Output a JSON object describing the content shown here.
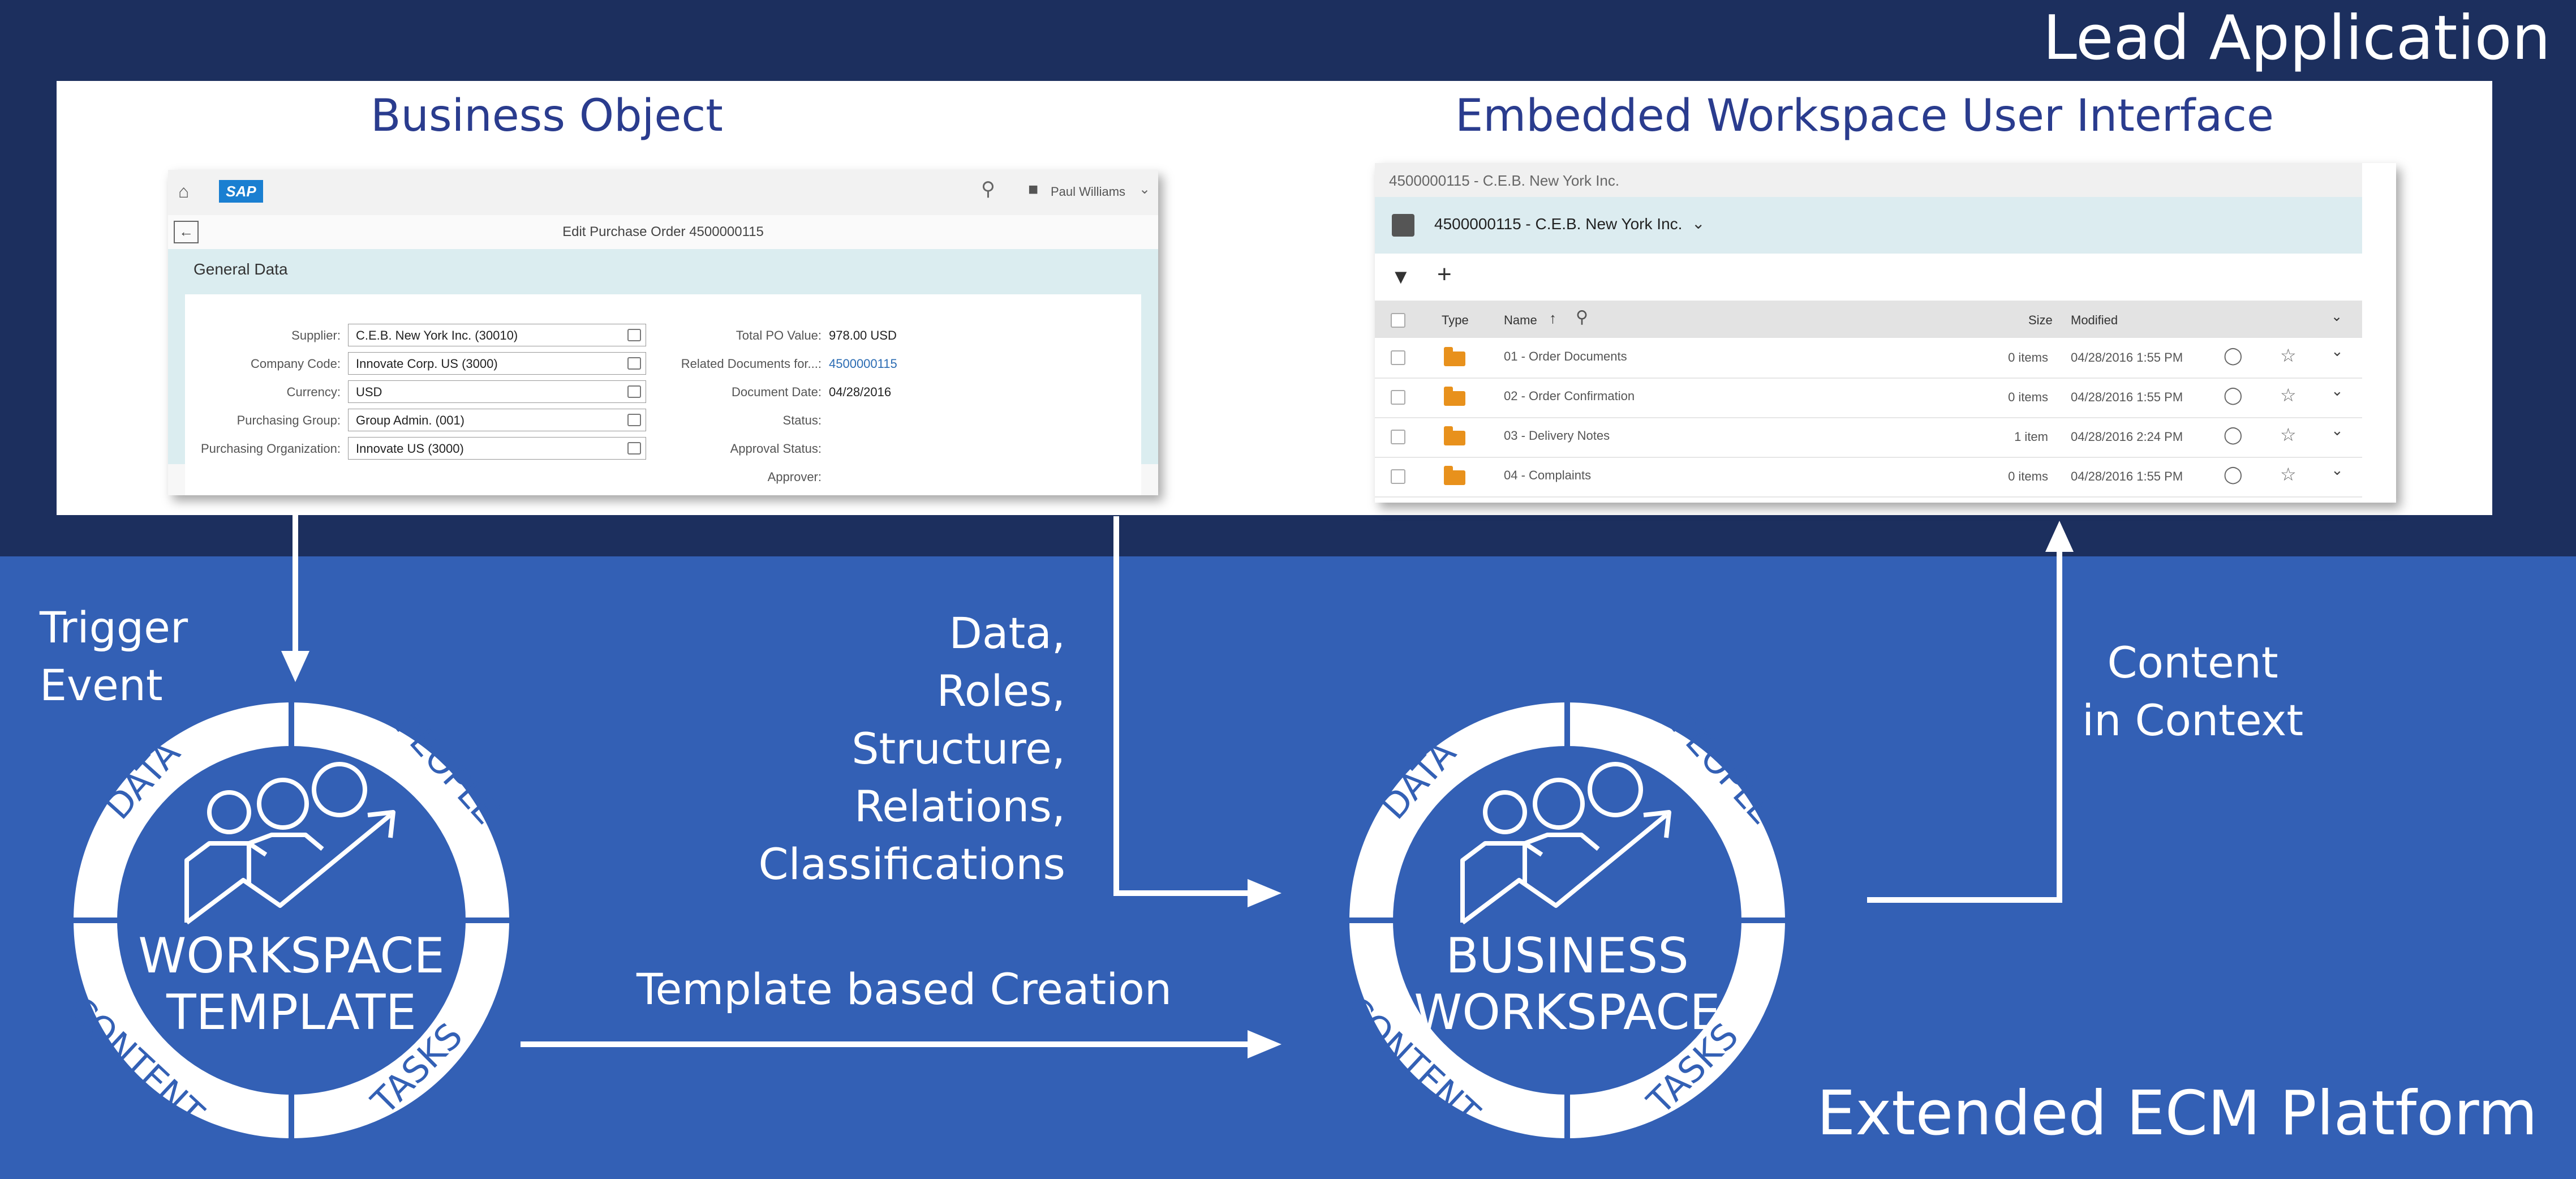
{
  "titles": {
    "lead": "Lead Application",
    "business_object": "Business Object",
    "embedded_ui": "Embedded Workspace User Interface",
    "platform": "Extended ECM Platform"
  },
  "labels": {
    "trigger_line1": "Trigger",
    "trigger_line2": "Event",
    "data_lines": [
      "Data,",
      "Roles,",
      "Structure,",
      "Relations,",
      "Classifications"
    ],
    "template_creation": "Template based Creation",
    "content_line1": "Content",
    "content_line2": "in Context"
  },
  "wheels": {
    "template": {
      "line1": "WORKSPACE",
      "line2": "TEMPLATE"
    },
    "business": {
      "line1": "BUSINESS",
      "line2": "WORKSPACE"
    },
    "segments": {
      "data": "DATA",
      "people": "PEOPLE",
      "content": "CONTENT",
      "tasks": "TASKS"
    }
  },
  "sap": {
    "logo": "SAP",
    "user": "Paul Williams",
    "page_title": "Edit Purchase Order 4500000115",
    "section": "General Data",
    "left_fields": [
      {
        "label": "Supplier:",
        "value": "C.E.B. New York Inc. (30010)"
      },
      {
        "label": "Company Code:",
        "value": "Innovate Corp. US (3000)"
      },
      {
        "label": "Currency:",
        "value": "USD"
      },
      {
        "label": "Purchasing Group:",
        "value": "Group Admin. (001)"
      },
      {
        "label": "Purchasing Organization:",
        "value": "Innovate US (3000)"
      }
    ],
    "right_fields": [
      {
        "label": "Total PO Value:",
        "value": "978.00 USD"
      },
      {
        "label": "Related Documents for...:",
        "value": "4500000115"
      },
      {
        "label": "Document Date:",
        "value": "04/28/2016"
      },
      {
        "label": "Status:",
        "value": ""
      },
      {
        "label": "Approval Status:",
        "value": ""
      },
      {
        "label": "Approver:",
        "value": ""
      }
    ]
  },
  "workspace_ui": {
    "breadcrumb": "4500000115 - C.E.B. New York Inc.",
    "title": "4500000115 - C.E.B. New York Inc.",
    "columns": {
      "type": "Type",
      "name": "Name",
      "size": "Size",
      "modified": "Modified"
    },
    "rows": [
      {
        "name": "01 - Order Documents",
        "size": "0 items",
        "modified": "04/28/2016 1:55 PM"
      },
      {
        "name": "02 - Order Confirmation",
        "size": "0 items",
        "modified": "04/28/2016 1:55 PM"
      },
      {
        "name": "03 - Delivery Notes",
        "size": "1 item",
        "modified": "04/28/2016 2:24 PM"
      },
      {
        "name": "04 - Complaints",
        "size": "0 items",
        "modified": "04/28/2016 1:55 PM"
      }
    ]
  },
  "colors": {
    "navy": "#1c2f5e",
    "blue": "#3360b5",
    "white": "#ffffff",
    "title_blue": "#2a3c8e",
    "folder": "#e8911c"
  }
}
